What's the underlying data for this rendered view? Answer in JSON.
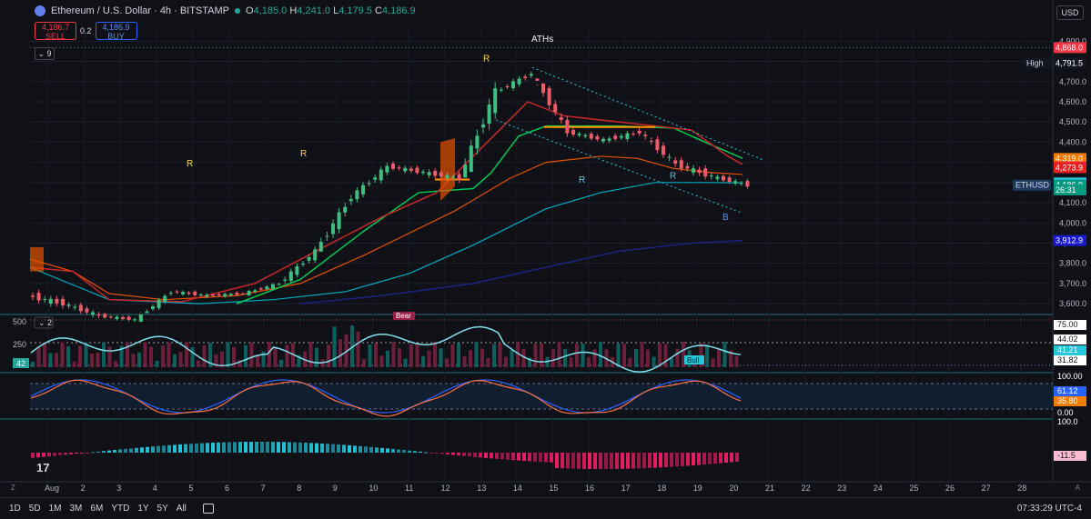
{
  "header": {
    "symbol_title": "Ethereum / U.S. Dollar · 4h · BITSTAMP",
    "open_label": "O",
    "open": "4,185.0",
    "high_label": "H",
    "high": "4,241.0",
    "low_label": "L",
    "low": "4,179.5",
    "close_label": "C",
    "close": "4,186.9",
    "sell_price": "4,186.7",
    "sell_label": "SELL",
    "spread": "0.2",
    "buy_price": "4,186.9",
    "buy_label": "BUY",
    "indicator_count": "9",
    "currency": "USD"
  },
  "annotations": {
    "aths": "ATHs",
    "bear": "Bear",
    "bull": "Bull",
    "r": "R",
    "b": "B"
  },
  "price_axis": {
    "ticks": [
      "4,900.0",
      "4,800.0",
      "4,700.0",
      "4,600.0",
      "4,500.0",
      "4,400.0",
      "4,300.0",
      "4,200.0",
      "4,100.0",
      "4,000.0",
      "3,900.0",
      "3,800.0",
      "3,700.0",
      "3,600.0"
    ],
    "labels": [
      {
        "text": "4,868.0",
        "price": 4868,
        "bg": "#f23645"
      },
      {
        "text": "4,791.5",
        "price": 4791.5,
        "bg": "#131722",
        "tag": "High"
      },
      {
        "text": "4,319.0",
        "price": 4319,
        "bg": "#f57c00"
      },
      {
        "text": "4,278.5",
        "price": 4278.5,
        "bg": "#f23645"
      },
      {
        "text": "4,273.9",
        "price": 4273.9,
        "bg": "#e91e1e"
      },
      {
        "text": "4,198.1",
        "price": 4198.1,
        "bg": "#26c6da"
      },
      {
        "text": "4,186.9",
        "price": 4186.9,
        "bg": "#089981",
        "tag": "ETHUSD"
      },
      {
        "text": "26:31",
        "price": 4164,
        "bg": "#089981"
      },
      {
        "text": "3,912.9",
        "price": 3912.9,
        "bg": "#1a1acc"
      }
    ]
  },
  "volume_panel": {
    "indicator_count": "2",
    "left_ticks": [
      "500",
      "250"
    ],
    "left_label": "42",
    "right_labels": [
      {
        "text": "44.02",
        "bg": "#ffffff"
      },
      {
        "text": "41.21",
        "bg": "#26c6da"
      },
      {
        "text": "31.82",
        "bg": "#ffffff"
      },
      {
        "text": "75.00",
        "bg": "#ffffff"
      }
    ]
  },
  "stoch_panel": {
    "right_labels": [
      {
        "text": "100.00",
        "bg": "#0f1117"
      },
      {
        "text": "61.12",
        "bg": "#2962ff"
      },
      {
        "text": "35.80",
        "bg": "#f57c00"
      },
      {
        "text": "0.00",
        "bg": "#0f1117"
      }
    ]
  },
  "macd_panel": {
    "right_labels": [
      {
        "text": "100.0",
        "bg": "#0f1117"
      },
      {
        "text": "-11.5",
        "bg": "#f8bbd0"
      }
    ]
  },
  "time_axis": {
    "labels": [
      "Aug",
      "2",
      "3",
      "4",
      "5",
      "6",
      "7",
      "8",
      "9",
      "10",
      "11",
      "12",
      "13",
      "14",
      "15",
      "16",
      "17",
      "18",
      "19",
      "20",
      "21",
      "22",
      "23",
      "24",
      "25",
      "26",
      "27",
      "28"
    ]
  },
  "bottom_bar": {
    "ranges": [
      "1D",
      "5D",
      "1M",
      "3M",
      "6M",
      "YTD",
      "1Y",
      "5Y",
      "All"
    ],
    "clock": "07:33:29 UTC-4"
  },
  "chart_data": {
    "type": "candlestick",
    "title": "Ethereum / U.S. Dollar · 4h · BITSTAMP",
    "x_label": "",
    "y_label": "",
    "ylim": [
      3560,
      4960
    ],
    "x": [
      "Aug 1",
      "Aug 2",
      "Aug 3",
      "Aug 4",
      "Aug 5",
      "Aug 6",
      "Aug 7",
      "Aug 8",
      "Aug 9",
      "Aug 10",
      "Aug 11",
      "Aug 12",
      "Aug 13",
      "Aug 14",
      "Aug 15",
      "Aug 16",
      "Aug 17",
      "Aug 18",
      "Aug 19",
      "Aug 20"
    ],
    "close": [
      3600,
      3540,
      3520,
      3660,
      3640,
      3650,
      3700,
      3860,
      4130,
      4280,
      4250,
      4220,
      4650,
      4740,
      4450,
      4410,
      4450,
      4290,
      4230,
      4187
    ],
    "high": [
      3820,
      3700,
      3600,
      3720,
      3710,
      3710,
      3760,
      3920,
      4200,
      4330,
      4340,
      4400,
      4760,
      4792,
      4680,
      4520,
      4560,
      4480,
      4380,
      4241
    ],
    "low": [
      3560,
      3500,
      3480,
      3560,
      3580,
      3600,
      3640,
      3690,
      3860,
      4080,
      4160,
      4180,
      4270,
      4590,
      4370,
      4350,
      4370,
      4200,
      4120,
      4060
    ],
    "reference_lines": {
      "aths": 4868,
      "high": 4791.5,
      "sma_long": 3912.9,
      "ema_fast": 4273.9,
      "ema_mid": 4278.5,
      "ema_slow": 4319.0,
      "ema_teal": 4198.1
    },
    "grid": true
  }
}
